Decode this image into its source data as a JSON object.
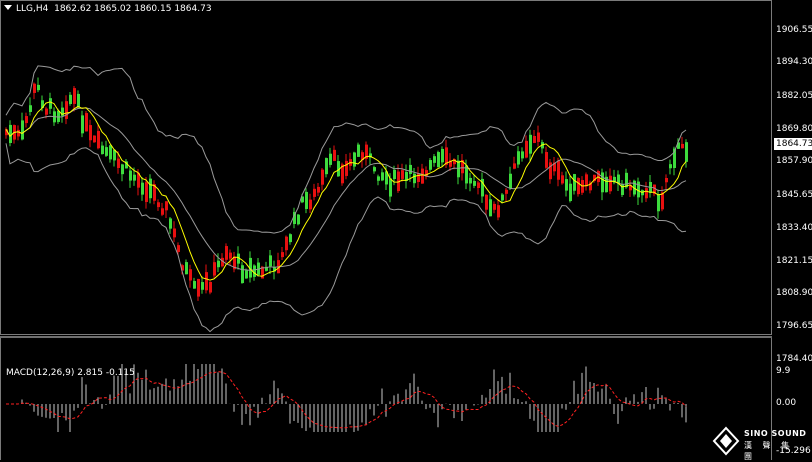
{
  "header": {
    "symbol": "LLG,H4",
    "ohlc": "1862.62 1865.02 1860.15 1864.73"
  },
  "price_axis": {
    "labels": [
      "1906.55",
      "1894.30",
      "1882.05",
      "1869.80",
      "1857.90",
      "1845.65",
      "1833.40",
      "1821.15",
      "1808.90",
      "1796.65",
      "1784.40"
    ],
    "current": "1864.73"
  },
  "macd": {
    "label": "MACD(12,26,9) 2.815 -0.115",
    "axis": [
      "9.9",
      "0.00",
      "-15.296"
    ]
  },
  "logo": {
    "line1": "SINO SOUND",
    "line2": "漢 聲 集 團"
  },
  "colors": {
    "bull": "#e81010",
    "bear": "#3ddc3d",
    "ma": "#ffff00",
    "bands": "#9a9a9a",
    "signal": "#ff2020",
    "hist": "#c8c8c8"
  }
}
